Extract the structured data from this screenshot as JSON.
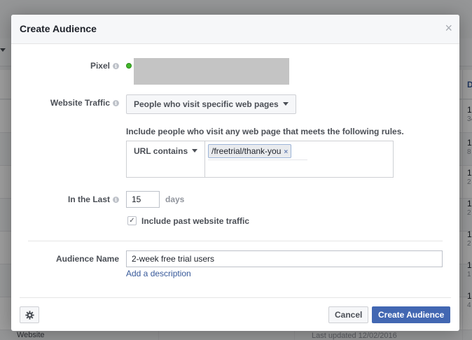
{
  "background": {
    "column_header": "D",
    "rows": [
      {
        "value": "1",
        "sub": "34"
      },
      {
        "value": "1",
        "sub": "8"
      },
      {
        "value": "1",
        "sub": "2"
      },
      {
        "value": "1",
        "sub": "2"
      },
      {
        "value": "1",
        "sub": "2"
      },
      {
        "value": "1",
        "sub": "1"
      },
      {
        "value": "1",
        "sub": "4"
      }
    ],
    "bottom_left": "Website",
    "bottom_right": "Last updated 12/02/2016"
  },
  "dialog": {
    "title": "Create Audience",
    "close_glyph": "×",
    "pixel_label": "Pixel",
    "website_traffic_label": "Website Traffic",
    "website_traffic_value": "People who visit specific web pages",
    "rule_description": "Include people who visit any web page that meets the following rules.",
    "rule_type": "URL contains",
    "rule_token": "/freetrial/thank-you",
    "token_remove_glyph": "×",
    "in_the_last_label": "In the Last",
    "in_the_last_value": "15",
    "days_label": "days",
    "include_past_checked": true,
    "include_past_label": "Include past website traffic",
    "audience_name_label": "Audience Name",
    "audience_name_value": "2-week free trial users",
    "add_description": "Add a description",
    "cancel_label": "Cancel",
    "create_label": "Create Audience",
    "info_glyph": "i",
    "check_glyph": "✓"
  },
  "colors": {
    "primary": "#4267b2",
    "link": "#365899",
    "pixel_status": "#42b72a"
  },
  "icons": [
    "close-icon",
    "info-icon",
    "caret-down-icon",
    "gear-icon",
    "checkmark-icon",
    "status-dot-icon"
  ]
}
